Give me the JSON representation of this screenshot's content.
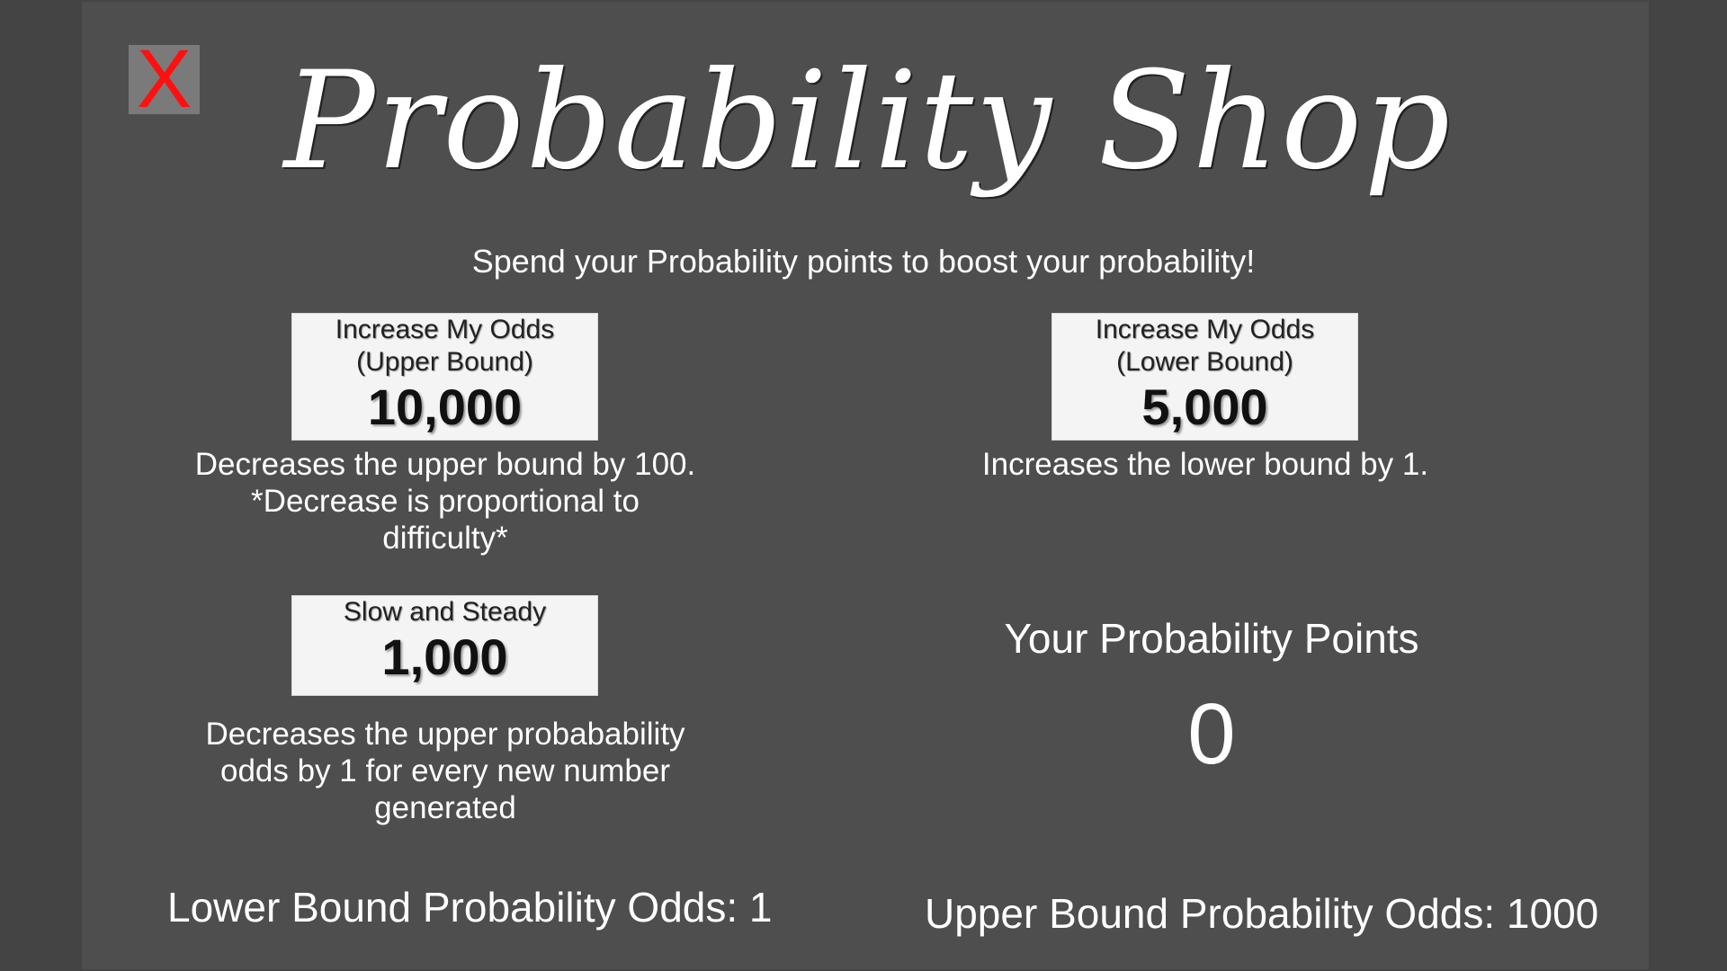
{
  "close_button": {
    "label": "X",
    "color": "#ff1010"
  },
  "title": "Probability Shop",
  "subtitle": "Spend your Probability points to boost your probability!",
  "items": {
    "upper": {
      "name_line1": "Increase My Odds",
      "name_line2": "(Upper Bound)",
      "price": "10,000",
      "desc_line1": "Decreases the upper bound by 100.",
      "desc_line2": "*Decrease is proportional to",
      "desc_line3": "difficulty*"
    },
    "lower": {
      "name_line1": "Increase My Odds",
      "name_line2": "(Lower Bound)",
      "price": "5,000",
      "desc_line1": "Increases the lower bound by 1."
    },
    "slow": {
      "name_line1": "Slow and Steady",
      "price": "1,000",
      "desc_line1": "Decreases the upper probabability",
      "desc_line2": "odds by 1 for every new number",
      "desc_line3": "generated"
    }
  },
  "points": {
    "label": "Your Probability Points",
    "value": "0"
  },
  "odds": {
    "lower": "Lower Bound Probability Odds: 1",
    "upper": "Upper Bound Probability Odds: 1000"
  }
}
